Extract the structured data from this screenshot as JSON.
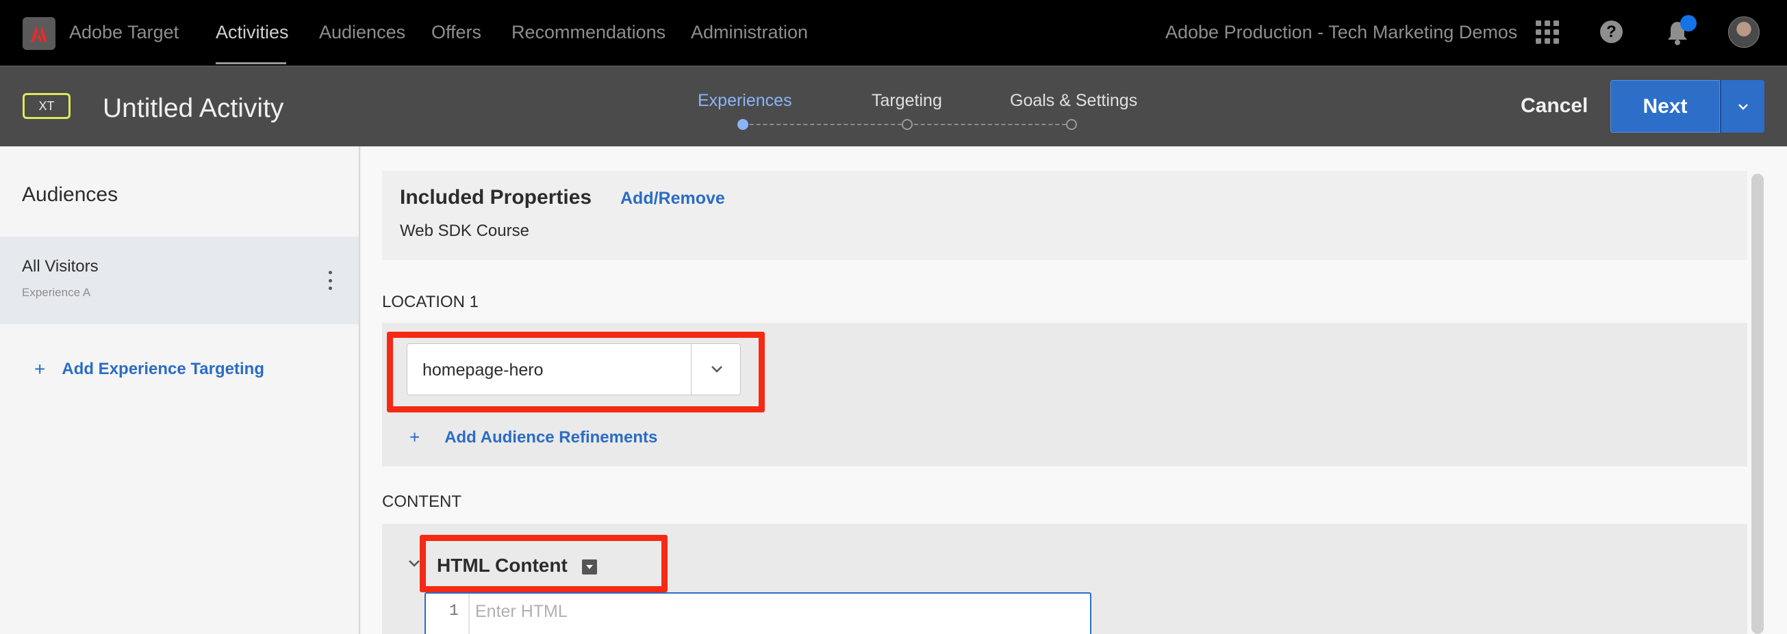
{
  "topnav": {
    "app_name": "Adobe Target",
    "links": [
      "Activities",
      "Audiences",
      "Offers",
      "Recommendations",
      "Administration"
    ],
    "active_link": "Activities",
    "org_name": "Adobe Production - Tech Marketing Demos",
    "icons": [
      "adobe-logo-icon",
      "apps-grid-icon",
      "help-icon",
      "bell-icon",
      "user-avatar"
    ]
  },
  "activity": {
    "type_badge": "XT",
    "title": "Untitled Activity",
    "steps": [
      "Experiences",
      "Targeting",
      "Goals & Settings"
    ],
    "active_step": "Experiences",
    "cancel_label": "Cancel",
    "next_label": "Next"
  },
  "sidebar": {
    "title": "Audiences",
    "items": [
      {
        "name": "All Visitors",
        "experience": "Experience A"
      }
    ],
    "add_targeting_label": "Add Experience Targeting"
  },
  "main": {
    "properties": {
      "title": "Included Properties",
      "link": "Add/Remove",
      "value": "Web SDK Course"
    },
    "location": {
      "label": "LOCATION 1",
      "selected": "homepage-hero",
      "add_refinements_label": "Add Audience Refinements"
    },
    "content": {
      "label": "CONTENT",
      "type": "HTML Content",
      "editor_line": "1",
      "editor_placeholder": "Enter HTML"
    }
  },
  "colors": {
    "accent": "#2d6ec8",
    "highlight": "#f52a14",
    "badge_border": "#e0e85a",
    "active_step": "#8ab4f8"
  }
}
